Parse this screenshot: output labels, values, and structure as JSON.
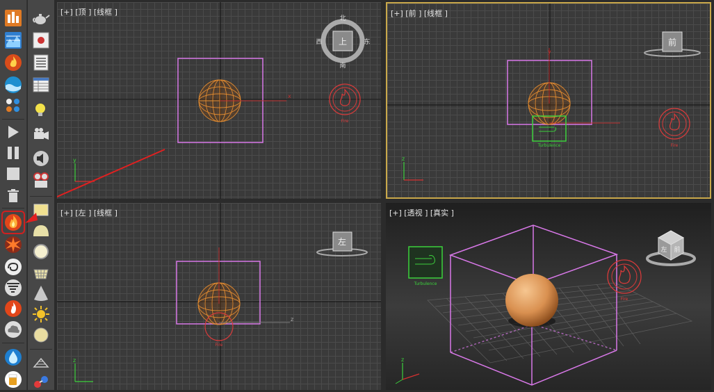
{
  "viewports": {
    "top": {
      "label": "[+] [顶 ] [线框 ]",
      "compass": {
        "north": "北",
        "south": "南",
        "east": "东",
        "west": "西",
        "cube_face": "上"
      }
    },
    "front": {
      "label": "[+] [前 ] [线框 ]",
      "cube_face": "前"
    },
    "left": {
      "label": "[+] [左 ] [线框 ]",
      "cube_face": "左"
    },
    "perspective": {
      "label": "[+] [透视 ] [真实 ]",
      "cube_faces": [
        "左",
        "前"
      ]
    }
  },
  "objects": {
    "fire_label": "Fire",
    "turbulence_label": "Turbulence"
  },
  "axis_labels": {
    "x": "x",
    "y": "y",
    "z": "z"
  },
  "colors": {
    "bounding_box": "#d878e8",
    "sphere": "#e08a30",
    "fire_icon": "#d83a3a",
    "turbulence": "#3cd23c",
    "active_border": "#c9a84a",
    "arrow": "#e02020"
  },
  "toolbar_left_icons": [
    "city-icon",
    "chart-icon",
    "fire-icon",
    "water-icon",
    "dots-icon",
    "play-icon",
    "pause-icon",
    "stop-icon",
    "trash-icon",
    "fire-effect-icon",
    "explosion-icon",
    "smoke-icon",
    "tornado-icon",
    "flame-icon",
    "cloud-icon",
    "raindrop-icon",
    "beer-icon"
  ],
  "toolbar_right_icons": [
    "teapot-icon",
    "image-icon",
    "list-icon",
    "table-icon",
    "lightbulb-icon",
    "camera-icon",
    "speaker-icon",
    "film-camera-icon",
    "panel-icon",
    "dome-icon",
    "circle-icon",
    "basket-icon",
    "cone-icon",
    "sun-icon",
    "sphere-icon",
    "grid-icon",
    "molecule-icon"
  ]
}
